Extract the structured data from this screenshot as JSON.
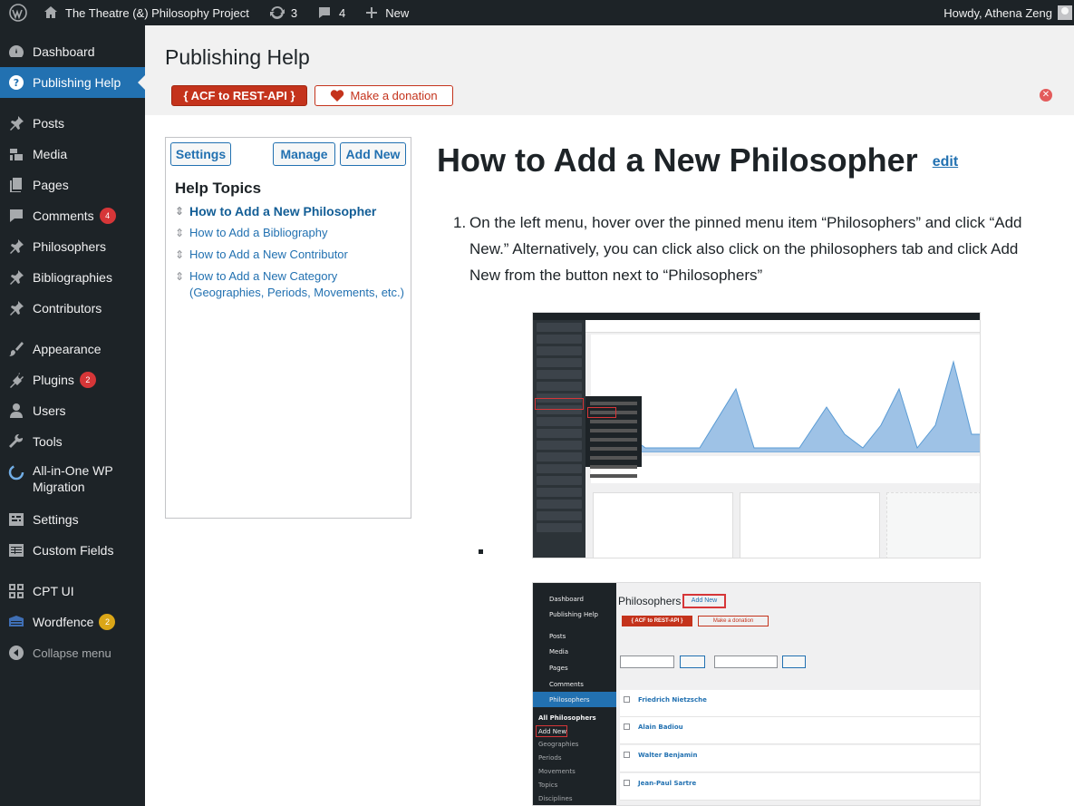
{
  "adminbar": {
    "site_name": "The Theatre (&) Philosophy Project",
    "updates_count": "3",
    "comments_count": "4",
    "new_label": "New",
    "greeting": "Howdy, Athena Zeng"
  },
  "sidebar": {
    "items": [
      {
        "label": "Dashboard",
        "icon": "dashboard-icon"
      },
      {
        "label": "Publishing Help",
        "icon": "help-icon",
        "current": true
      },
      {
        "label": "Posts",
        "icon": "pin-icon"
      },
      {
        "label": "Media",
        "icon": "media-icon"
      },
      {
        "label": "Pages",
        "icon": "pages-icon"
      },
      {
        "label": "Comments",
        "icon": "comments-icon",
        "badge": "4"
      },
      {
        "label": "Philosophers",
        "icon": "pin-icon"
      },
      {
        "label": "Bibliographies",
        "icon": "pin-icon"
      },
      {
        "label": "Contributors",
        "icon": "pin-icon"
      },
      {
        "label": "Appearance",
        "icon": "brush-icon"
      },
      {
        "label": "Plugins",
        "icon": "plugin-icon",
        "badge": "2"
      },
      {
        "label": "Users",
        "icon": "users-icon"
      },
      {
        "label": "Tools",
        "icon": "wrench-icon"
      },
      {
        "label": "All-in-One WP Migration",
        "icon": "migration-icon"
      },
      {
        "label": "Settings",
        "icon": "settings-icon"
      },
      {
        "label": "Custom Fields",
        "icon": "table-icon"
      },
      {
        "label": "CPT UI",
        "icon": "cptui-icon"
      },
      {
        "label": "Wordfence",
        "icon": "wordfence-icon",
        "badge": "2"
      },
      {
        "label": "Collapse menu",
        "icon": "collapse-icon"
      }
    ]
  },
  "page": {
    "title": "Publishing Help",
    "acf_button": "{ ACF to REST-API }",
    "donate_button": "Make a donation"
  },
  "helpbox": {
    "settings_btn": "Settings",
    "manage_btn": "Manage",
    "add_new_btn": "Add New",
    "heading": "Help Topics",
    "topics": [
      "How to Add a New Philosopher",
      "How to Add a Bibliography",
      "How to Add a New Contributor",
      "How to Add a New Category (Geographies, Periods, Movements, etc.)"
    ]
  },
  "article": {
    "title": "How to Add a New Philosopher",
    "edit_link": "edit",
    "step_number": "1.",
    "step_text": "On the left menu, hover over the pinned menu item “Philosophers” and click “Add New.” Alternatively, you can click also click on the philosophers tab and click Add New from the button next to “Philosophers”"
  },
  "screenshot2": {
    "page_title": "Philosophers",
    "add_new": "Add New",
    "acf": "{ ACF to REST-API }",
    "donate": "Make a donation",
    "rows": [
      "Friedrich Nietzsche",
      "Alain Badiou",
      "Walter Benjamin",
      "Jean-Paul Sartre"
    ],
    "menu": [
      "Dashboard",
      "Publishing Help",
      "Posts",
      "Media",
      "Pages",
      "Comments",
      "Philosophers",
      "All Philosophers",
      "Add New",
      "Geographies",
      "Periods",
      "Movements",
      "Topics",
      "Disciplines"
    ]
  },
  "colors": {
    "accent": "#2271b1",
    "acf_red": "#c4331c",
    "admin_dark": "#1d2327"
  }
}
